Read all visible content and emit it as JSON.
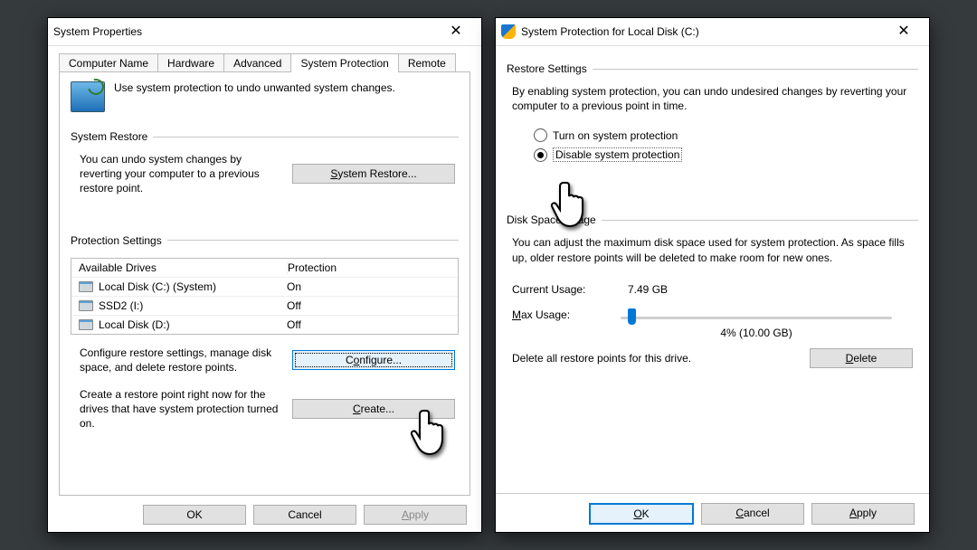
{
  "left": {
    "title": "System Properties",
    "tabs": [
      "Computer Name",
      "Hardware",
      "Advanced",
      "System Protection",
      "Remote"
    ],
    "active_tab": 3,
    "intro": "Use system protection to undo unwanted system changes.",
    "group1": "System Restore",
    "restore_desc": "You can undo system changes by reverting your computer to a previous restore point.",
    "restore_btn": "System Restore...",
    "group2": "Protection Settings",
    "col_drives": "Available Drives",
    "col_prot": "Protection",
    "drives": [
      {
        "name": "Local Disk (C:) (System)",
        "prot": "On"
      },
      {
        "name": "SSD2 (I:)",
        "prot": "Off"
      },
      {
        "name": "Local Disk (D:)",
        "prot": "Off"
      }
    ],
    "configure_desc": "Configure restore settings, manage disk space, and delete restore points.",
    "configure_btn": "Configure...",
    "create_desc": "Create a restore point right now for the drives that have system protection turned on.",
    "create_btn": "Create...",
    "ok": "OK",
    "cancel": "Cancel",
    "apply": "Apply"
  },
  "right": {
    "title": "System Protection for Local Disk (C:)",
    "group_restore": "Restore Settings",
    "restore_desc": "By enabling system protection, you can undo undesired changes by reverting your computer to a previous point in time.",
    "radio_on": "Turn on system protection",
    "radio_off": "Disable system protection",
    "selected_radio": "off",
    "group_disk": "Disk Space Usage",
    "disk_desc": "You can adjust the maximum disk space used for system protection. As space fills up, older restore points will be deleted to make room for new ones.",
    "current_label": "Current Usage:",
    "current_value": "7.49 GB",
    "max_label": "Max Usage:",
    "slider_text": "4% (10.00 GB)",
    "slider_percent": 4,
    "delete_desc": "Delete all restore points for this drive.",
    "delete_btn": "Delete",
    "ok": "OK",
    "cancel": "Cancel",
    "apply": "Apply"
  }
}
